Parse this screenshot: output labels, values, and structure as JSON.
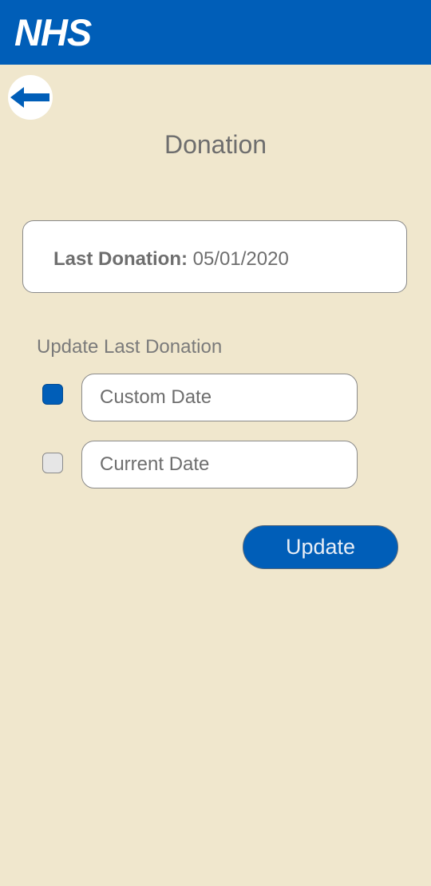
{
  "header": {
    "logo_text": "NHS",
    "background_color": "#005eb8"
  },
  "back_button": {
    "icon": "arrow-left-icon"
  },
  "page": {
    "title": "Donation"
  },
  "last_donation": {
    "label": "Last Donation:",
    "value": "05/01/2020"
  },
  "update_section": {
    "label": "Update Last Donation",
    "options": [
      {
        "placeholder": "Custom Date",
        "checked": true
      },
      {
        "placeholder": "Current Date",
        "checked": false
      }
    ]
  },
  "update_button": {
    "label": "Update"
  },
  "colors": {
    "background": "#f0e7cd",
    "accent": "#005eb8"
  }
}
